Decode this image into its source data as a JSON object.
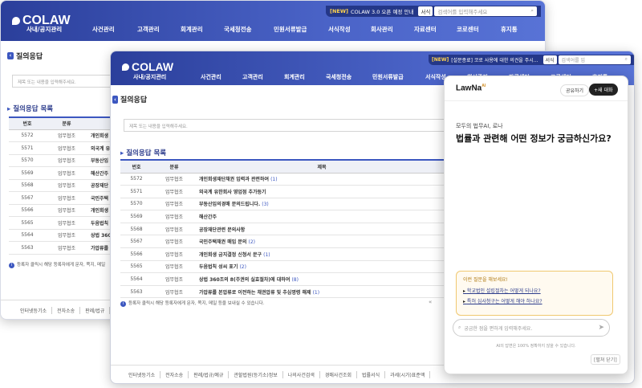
{
  "back": {
    "logo": "COLAW",
    "nav": [
      "사내/공지관리",
      "사건관리",
      "고객관리",
      "회계관리",
      "국세청전송",
      "민원서류발급",
      "서식작성",
      "회사관리",
      "자료센터",
      "코로센터",
      "휴지통"
    ],
    "topbar": {
      "badge": "[NEW]",
      "text": "COLAW 3.0 오픈 예정 안내",
      "select": "서식",
      "search": "검색어를 입력해주세요"
    },
    "page_title": "질의응답",
    "search_placeholder": "제목 또는 내용을 입력해주세요.",
    "section_title": "질의응답 목록",
    "headers": [
      "번호",
      "분류"
    ],
    "rows": [
      {
        "no": "5572",
        "cat": "업무협조",
        "title": "개인회생"
      },
      {
        "no": "5571",
        "cat": "업무협조",
        "title": "외국계 유"
      },
      {
        "no": "5570",
        "cat": "업무협조",
        "title": "부동산임"
      },
      {
        "no": "5569",
        "cat": "업무협조",
        "title": "해산간주"
      },
      {
        "no": "5568",
        "cat": "업무협조",
        "title": "공장재단"
      },
      {
        "no": "5567",
        "cat": "업무협조",
        "title": "국민주택"
      },
      {
        "no": "5566",
        "cat": "업무협조",
        "title": "개인회생"
      },
      {
        "no": "5565",
        "cat": "업무협조",
        "title": "두음법칙"
      },
      {
        "no": "5564",
        "cat": "업무협조",
        "title": "상법 360"
      },
      {
        "no": "5563",
        "cat": "업무협조",
        "title": "가압류를"
      }
    ],
    "note": "등록자 클릭시 해당 등록자에게 문자, 쪽지, 메일",
    "footer": [
      "인터넷등기소",
      "전자소송",
      "판례/법규"
    ]
  },
  "front": {
    "logo": "COLAW",
    "nav": [
      "사내/공지관리",
      "사건관리",
      "고객관리",
      "회계관리",
      "국세청전송",
      "민원서류발급",
      "서식작성",
      "회사관리",
      "자료센터",
      "코로센터",
      "휴지통"
    ],
    "topbar": {
      "badge": "[NEW]",
      "text": "[설문종료] 코로 사용에 대한 의견을 주시...",
      "select": "서식",
      "search": "검색어를 입"
    },
    "page_title": "질의응답",
    "search_placeholder": "제목 또는 내용을 입력해주세요.",
    "section_title": "질의응답 목록",
    "headers": [
      "번호",
      "분류",
      "제목"
    ],
    "rows": [
      {
        "no": "5572",
        "cat": "업무협조",
        "title": "개인회생재단채권 입력과 관련하여",
        "count": "(1)"
      },
      {
        "no": "5571",
        "cat": "업무협조",
        "title": "외국계 유한회사 영업점 추가등기",
        "count": ""
      },
      {
        "no": "5570",
        "cat": "업무협조",
        "title": "부동산임의경매 문의드립니다.",
        "count": "(3)"
      },
      {
        "no": "5569",
        "cat": "업무협조",
        "title": "해산간주",
        "count": ""
      },
      {
        "no": "5568",
        "cat": "업무협조",
        "title": "공장재단관련 문의사항",
        "count": ""
      },
      {
        "no": "5567",
        "cat": "업무협조",
        "title": "국민주택채권 매입 문의",
        "count": "(2)"
      },
      {
        "no": "5566",
        "cat": "업무협조",
        "title": "개인회생 금지결정 신청서 문구",
        "count": "(1)"
      },
      {
        "no": "5565",
        "cat": "업무협조",
        "title": "두음법칙 성씨 표기",
        "count": "(2)"
      },
      {
        "no": "5564",
        "cat": "업무협조",
        "title": "상법 360조의 8(주권의 실효절차)에 대하여",
        "count": "(8)"
      },
      {
        "no": "5563",
        "cat": "업무협조",
        "title": "가압류를 본압류로 이전하는 채권압류 및 추심명령 해제",
        "count": "(1)"
      }
    ],
    "note": "등록자 클릭시 해당 등록자에게 문자, 쪽지, 메일 등을 보내실 수 있습니다.",
    "pager": "«",
    "footer": [
      "인터넷등기소",
      "전자소송",
      "판례/법규/예규",
      "관할법원(등기소)정보",
      "나의사건검색",
      "경매사건조회",
      "법률서식",
      "과세(시가)표준액"
    ]
  },
  "chat": {
    "logo": "LawNa",
    "logo_ai": "AI",
    "share": "공유하기",
    "new_chat": "+새 대화",
    "sub": "모두의 법무AI, 로나",
    "headline": "법률과 관련해 어떤 정보가 궁금하신가요?",
    "sugg_label": "이런 질문을 해보세요!",
    "suggestions": [
      "학교법인 설립절차는 어떻게 되나요?",
      "특허 심사청구는 어떻게 해야 하나요?"
    ],
    "input_placeholder": "궁금한 점을 편하게 입력해주세요.",
    "disclaimer": "AI의 답변은 100% 정확하지 않을 수 있습니다.",
    "close": "[펼쳐 닫기]"
  }
}
